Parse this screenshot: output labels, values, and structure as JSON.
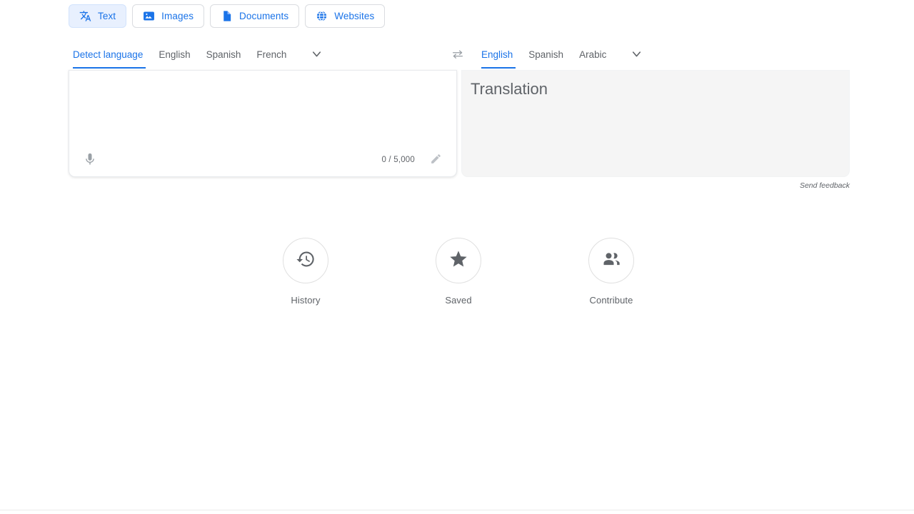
{
  "modes": {
    "items": [
      {
        "label": "Text",
        "icon": "translate-text-icon",
        "active": true
      },
      {
        "label": "Images",
        "icon": "image-icon",
        "active": false
      },
      {
        "label": "Documents",
        "icon": "document-icon",
        "active": false
      },
      {
        "label": "Websites",
        "icon": "globe-icon",
        "active": false
      }
    ]
  },
  "languages": {
    "source": {
      "items": [
        {
          "label": "Detect language",
          "active": true
        },
        {
          "label": "English",
          "active": false
        },
        {
          "label": "Spanish",
          "active": false
        },
        {
          "label": "French",
          "active": false
        }
      ],
      "more_icon": "chevron-down-icon"
    },
    "swap_icon": "swap-languages-icon",
    "target": {
      "items": [
        {
          "label": "English",
          "active": true
        },
        {
          "label": "Spanish",
          "active": false
        },
        {
          "label": "Arabic",
          "active": false
        }
      ],
      "more_icon": "chevron-down-icon"
    }
  },
  "source_panel": {
    "text": "",
    "placeholder": "",
    "mic_icon": "microphone-icon",
    "char_count": "0 / 5,000",
    "handwrite_icon": "pencil-icon"
  },
  "target_panel": {
    "placeholder": "Translation"
  },
  "feedback": {
    "label": "Send feedback"
  },
  "actions": [
    {
      "label": "History",
      "icon": "history-clock-icon"
    },
    {
      "label": "Saved",
      "icon": "star-filled-icon"
    },
    {
      "label": "Contribute",
      "icon": "people-group-icon"
    }
  ],
  "colors": {
    "accent_blue": "#1a73e8",
    "chip_active_bg": "#e8f0fe",
    "target_panel_bg": "#f5f5f5",
    "muted_text": "#5f6368"
  }
}
